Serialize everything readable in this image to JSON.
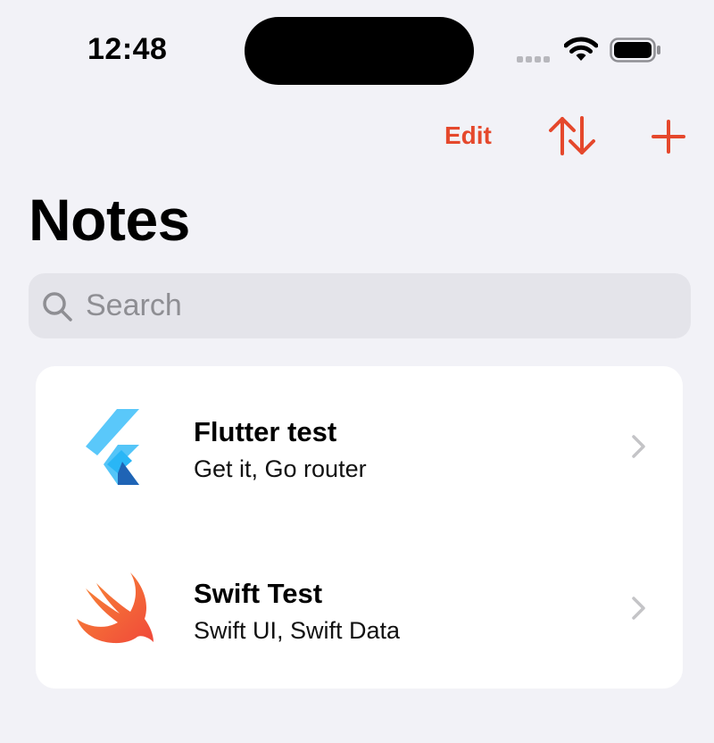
{
  "status_bar": {
    "time": "12:48"
  },
  "toolbar": {
    "edit_label": "Edit",
    "accent_color": "#e5482c"
  },
  "page": {
    "title": "Notes"
  },
  "search": {
    "placeholder": "Search"
  },
  "notes": [
    {
      "title": "Flutter test",
      "subtitle": "Get it, Go router",
      "icon": "flutter-logo"
    },
    {
      "title": "Swift Test",
      "subtitle": "Swift UI, Swift Data",
      "icon": "swift-logo"
    }
  ]
}
